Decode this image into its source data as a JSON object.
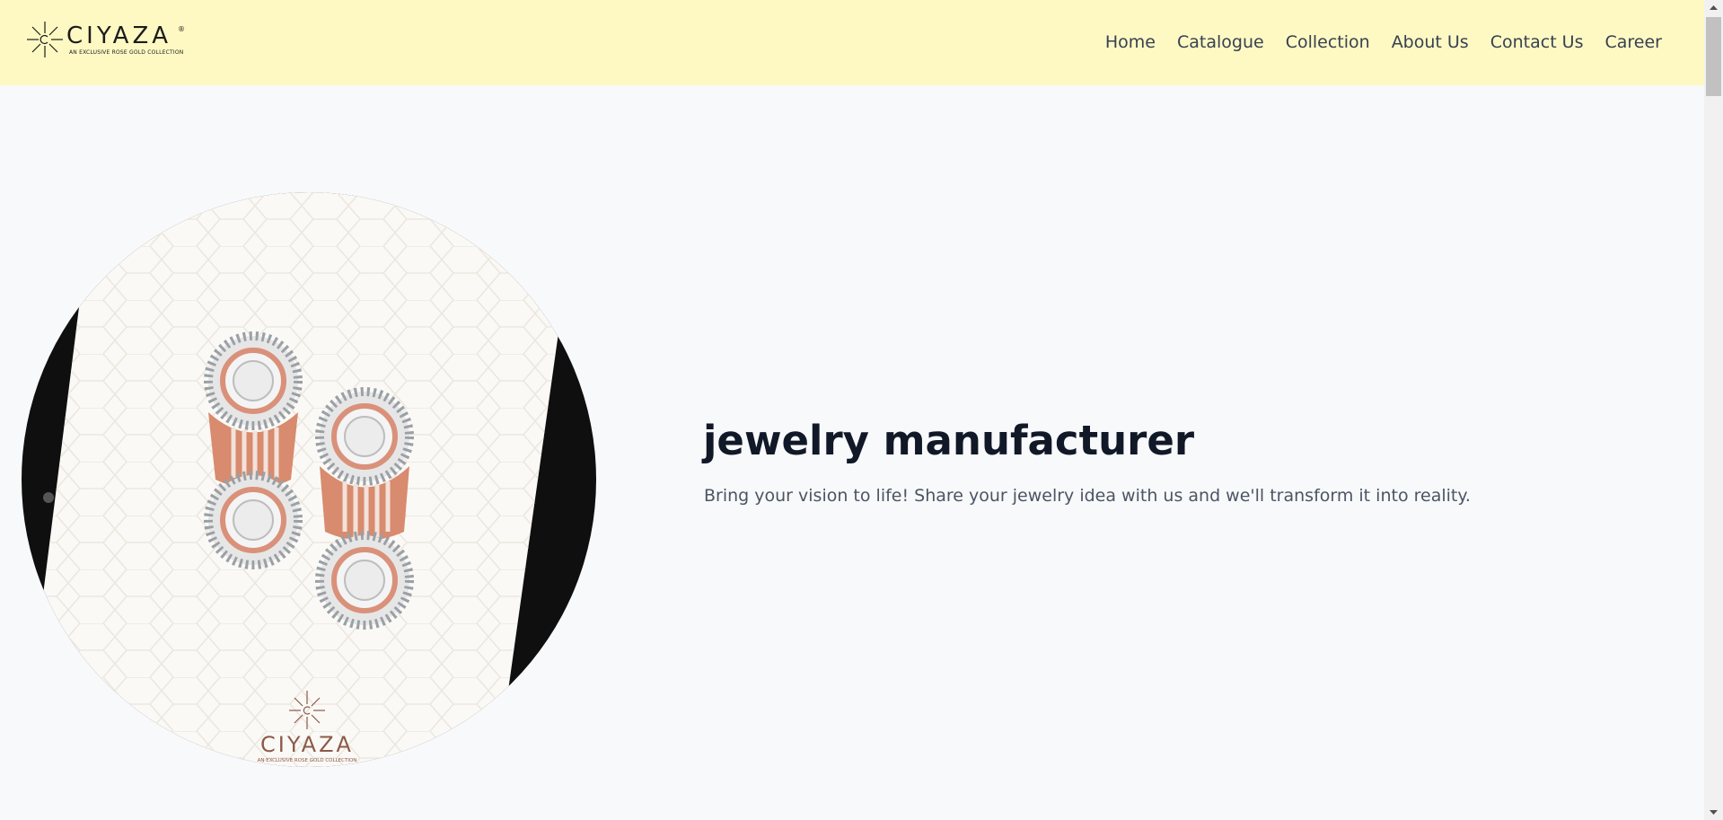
{
  "header": {
    "brand": "CIYAZA",
    "brand_reg": "®",
    "brand_tagline": "AN EXCLUSIVE ROSE GOLD COLLECTION",
    "nav": [
      {
        "label": "Home"
      },
      {
        "label": "Catalogue"
      },
      {
        "label": "Collection"
      },
      {
        "label": "About Us"
      },
      {
        "label": "Contact Us"
      },
      {
        "label": "Career"
      }
    ]
  },
  "hero": {
    "title": "jewelry manufacturer",
    "subtitle": "Bring your vision to life! Share your jewelry idea with us and we'll transform it into reality.",
    "image": {
      "brand": "CIYAZA",
      "brand_tagline": "AN EXCLUSIVE ROSE GOLD COLLECTION"
    }
  },
  "colors": {
    "header_bg": "#fef9c3",
    "page_bg": "#f8f9fb",
    "rose_gold": "#d88b6e",
    "text_dark": "#111827",
    "text_muted": "#4b5563"
  }
}
